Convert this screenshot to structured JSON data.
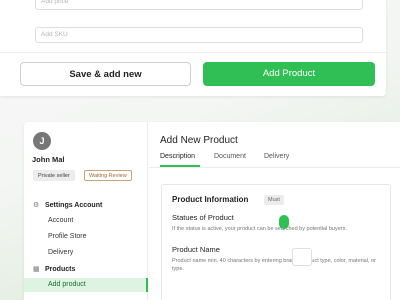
{
  "top_form": {
    "price_placeholder": "Add price",
    "sku_placeholder": "Add SKU",
    "save_new_label": "Save & add new",
    "add_product_label": "Add Product"
  },
  "user": {
    "initial": "J",
    "name": "John Mal",
    "badge_seller": "Private seller",
    "badge_status": "Waiting Review"
  },
  "sidebar": {
    "groups": [
      {
        "label": "Settings Account",
        "icon": "gear-icon",
        "items": [
          "Account",
          "Profile Store",
          "Delivery"
        ]
      },
      {
        "label": "Products",
        "icon": "grid-icon",
        "items": [
          "Add product"
        ]
      }
    ],
    "active_item": "Add product"
  },
  "main": {
    "title": "Add New Product",
    "tabs": [
      "Description",
      "Document",
      "Delivery"
    ],
    "active_tab": "Description",
    "section": {
      "title": "Product Information",
      "badge": "Must",
      "status_label": "Statues of Product",
      "status_help": "If the status is active, your product can be searched by potential buyers.",
      "name_label": "Product Name",
      "name_help": "Product name min. 40 characters by entering brand, product type, color, material, or type."
    }
  },
  "colors": {
    "accent": "#2fbf55",
    "active_bg": "#dff3e2",
    "badge_status_border": "#c9a37d"
  }
}
